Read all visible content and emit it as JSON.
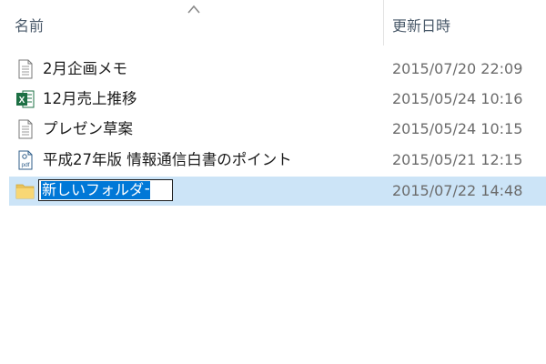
{
  "columns": {
    "name_label": "名前",
    "date_label": "更新日時",
    "sort_direction": "ascending"
  },
  "files": [
    {
      "name": "2月企画メモ",
      "date": "2015/07/20 22:09",
      "icon": "text-document-icon"
    },
    {
      "name": "12月売上推移",
      "date": "2015/05/24 10:16",
      "icon": "excel-file-icon"
    },
    {
      "name": "プレゼン草案",
      "date": "2015/05/24 10:15",
      "icon": "text-document-icon"
    },
    {
      "name": "平成27年版 情報通信白書のポイント",
      "date": "2015/05/21 12:15",
      "icon": "pdf-file-icon"
    }
  ],
  "new_folder": {
    "name": "新しいフォルダー",
    "date": "2015/07/22 14:48",
    "icon": "folder-icon",
    "editing": true
  },
  "colors": {
    "selection": "#cce4f7",
    "text_highlight": "#0078d7",
    "excel_green": "#1d7044",
    "folder_yellow": "#f8d775"
  }
}
